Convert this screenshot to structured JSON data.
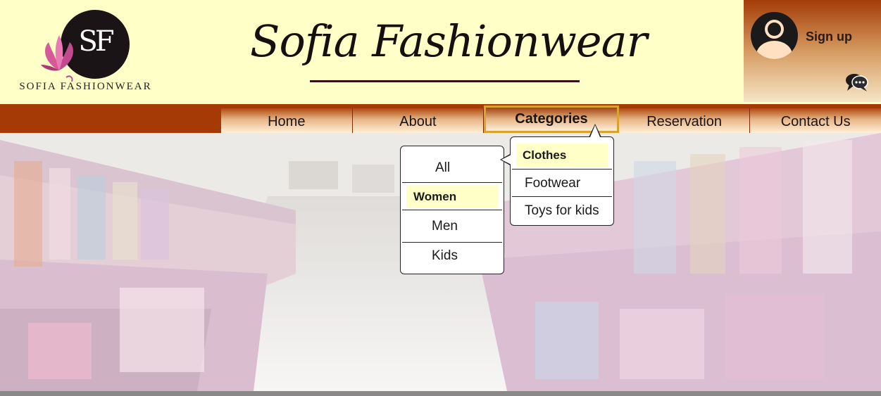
{
  "brand": {
    "logo_monogram": "SF",
    "logo_text": "SOFIA FASHIONWEAR",
    "title": "Sofia Fashionwear"
  },
  "account": {
    "signup_label": "Sign up",
    "avatar_icon": "user-avatar-icon",
    "chat_icon": "chat-bubbles-icon"
  },
  "nav": {
    "tabs": [
      {
        "label": "Home"
      },
      {
        "label": "About"
      },
      {
        "label": "Categories"
      },
      {
        "label": "Reservation"
      },
      {
        "label": "Contact Us"
      }
    ],
    "active": "Categories"
  },
  "categories_menu": {
    "items": [
      {
        "label": "All"
      },
      {
        "label": "Women"
      },
      {
        "label": "Men"
      },
      {
        "label": "Kids"
      }
    ],
    "highlighted": "Women"
  },
  "women_submenu": {
    "items": [
      {
        "label": "Clothes"
      },
      {
        "label": "Footwear"
      },
      {
        "label": "Toys for kids"
      }
    ],
    "highlighted": "Clothes"
  },
  "colors": {
    "header_bg": "#ffffc8",
    "nav_bar": "#a63a06",
    "active_border": "#d9a32d",
    "highlight_bg": "#ffffc8"
  }
}
